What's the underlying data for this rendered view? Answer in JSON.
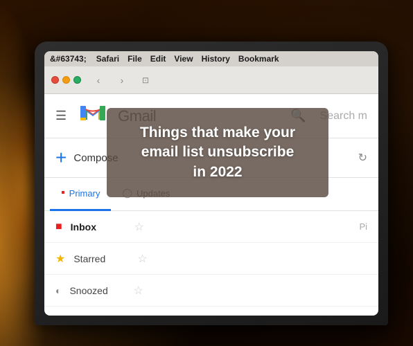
{
  "browser": {
    "menu_bar": {
      "apple": "&#63743;",
      "safari": "Safari",
      "file": "File",
      "edit": "Edit",
      "view": "View",
      "history": "History",
      "bookmarks": "Bookmark"
    },
    "toolbar": {
      "back": "‹",
      "forward": "›",
      "tab_icon": "⊡"
    }
  },
  "gmail": {
    "logo_text": "Gmail",
    "search_placeholder": "Search m",
    "compose_label": "Compose",
    "tabs": [
      {
        "label": "Primary",
        "active": true
      },
      {
        "label": "Updates",
        "active": false
      }
    ],
    "emails": [
      {
        "sender": "Inbox",
        "subject": "",
        "unread": true,
        "type": "inbox"
      },
      {
        "sender": "Starred",
        "subject": "",
        "unread": false,
        "type": "star"
      },
      {
        "sender": "Snoozed",
        "subject": "",
        "unread": false,
        "type": "snoozed"
      }
    ]
  },
  "overlay": {
    "line1": "Things that make your",
    "line2": "email list unsubscribe",
    "line3": "in 2022"
  },
  "colors": {
    "accent_blue": "#1a73e8",
    "gmail_red": "#e91e1e",
    "overlay_bg": "rgba(90,75,65,0.82)"
  }
}
